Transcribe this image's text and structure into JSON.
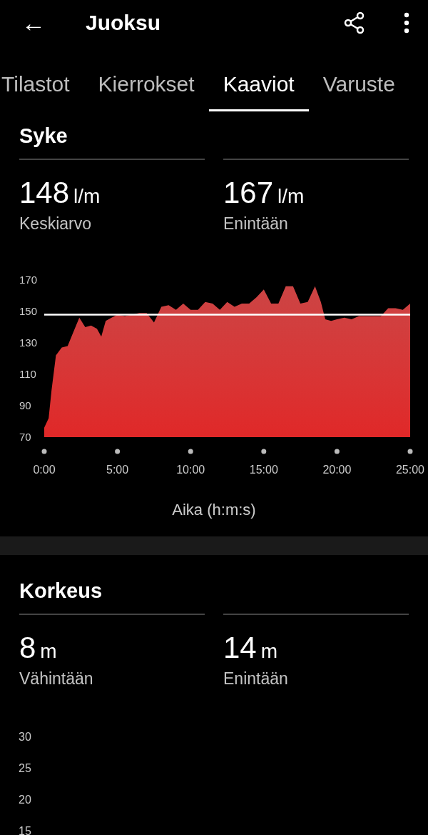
{
  "header": {
    "back_icon": "←",
    "title": "Juoksu"
  },
  "tabs": [
    {
      "label": "Tilastot",
      "selected": false
    },
    {
      "label": "Kierrokset",
      "selected": false
    },
    {
      "label": "Kaaviot",
      "selected": true
    },
    {
      "label": "Varuste",
      "selected": false
    }
  ],
  "heart_rate": {
    "title": "Syke",
    "stats": [
      {
        "value": "148",
        "unit": "l/m",
        "label": "Keskiarvo"
      },
      {
        "value": "167",
        "unit": "l/m",
        "label": "Enintään"
      }
    ],
    "chart_data": {
      "type": "area",
      "xlabel": "Aika (h:m:s)",
      "x": [
        0,
        0.3,
        0.5,
        0.8,
        1.2,
        1.6,
        2.0,
        2.4,
        2.8,
        3.2,
        3.6,
        3.9,
        4.2,
        4.6,
        5.0,
        5.5,
        6.0,
        6.5,
        7.0,
        7.5,
        8.0,
        8.5,
        9.0,
        9.5,
        10.0,
        10.5,
        11.0,
        11.5,
        12.0,
        12.5,
        13.0,
        13.5,
        14.0,
        14.5,
        15.0,
        15.5,
        16.0,
        16.5,
        17.0,
        17.5,
        18.0,
        18.5,
        18.9,
        19.2,
        19.6,
        20.0,
        20.5,
        21.0,
        21.5,
        22.0,
        22.5,
        23.0,
        23.5,
        24.0,
        24.5,
        25.0
      ],
      "series": [
        {
          "color": "#f05050",
          "values": [
            76,
            82,
            100,
            122,
            127,
            128,
            137,
            146,
            140,
            141,
            139,
            134,
            144,
            146,
            148,
            147,
            148,
            149,
            149,
            143,
            153,
            154,
            151,
            155,
            151,
            151,
            156,
            155,
            151,
            156,
            153,
            155,
            155,
            159,
            164,
            155,
            155,
            166,
            166,
            155,
            156,
            166,
            156,
            145,
            144,
            145,
            146,
            145,
            147,
            147,
            147,
            147,
            152,
            152,
            151,
            155
          ]
        }
      ],
      "xlim": [
        0,
        25
      ],
      "ylim": [
        70,
        170
      ],
      "xticks": [
        {
          "value": 0,
          "label": "0:00"
        },
        {
          "value": 5,
          "label": "5:00"
        },
        {
          "value": 10,
          "label": "10:00"
        },
        {
          "value": 15,
          "label": "15:00"
        },
        {
          "value": 20,
          "label": "20:00"
        },
        {
          "value": 25,
          "label": "25:00"
        }
      ],
      "yticks": [
        70,
        90,
        110,
        130,
        150,
        170
      ],
      "ref_lines": [
        {
          "axis": "y",
          "value": 148
        }
      ]
    }
  },
  "altitude": {
    "title": "Korkeus",
    "stats": [
      {
        "value": "8",
        "unit": "m",
        "label": "Vähintään"
      },
      {
        "value": "14",
        "unit": "m",
        "label": "Enintään"
      }
    ],
    "y_labels": [
      "30",
      "25",
      "20",
      "15"
    ]
  }
}
